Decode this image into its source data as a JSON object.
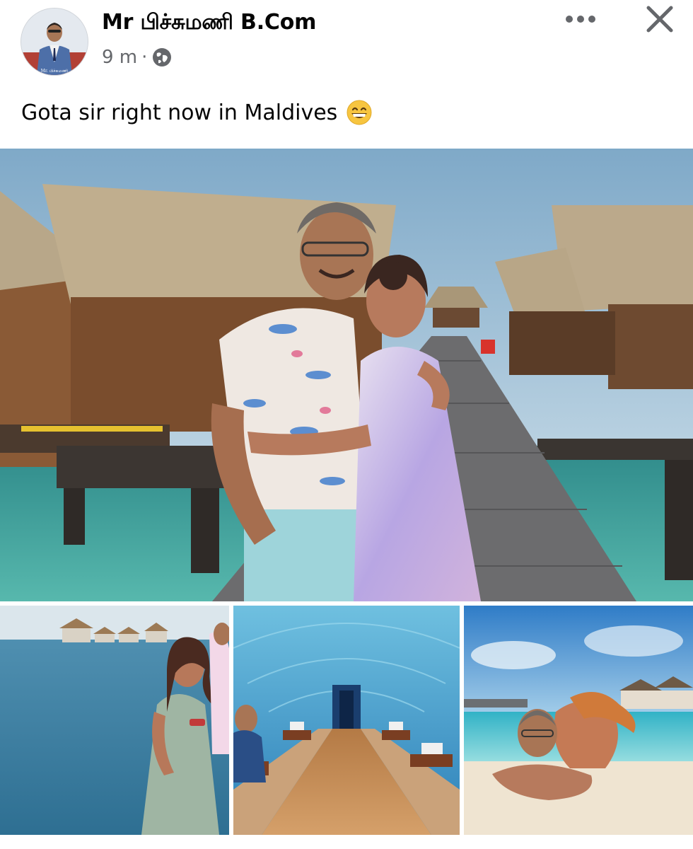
{
  "post": {
    "author": "Mr பிச்சுமணி B.Com",
    "timestamp": "9 m",
    "separator": "·",
    "audience_icon": "globe-icon",
    "caption": "Gota sir right now in Maldives",
    "caption_emoji": "grinning-face-icon",
    "header_icons": [
      "more-options-icon",
      "close-icon"
    ],
    "avatar_text": "Mr. பிச்சுமணி",
    "photos": [
      {
        "id": "main",
        "description_icon": "overwater-villa-photo"
      },
      {
        "id": "sea",
        "description_icon": "sea-photo"
      },
      {
        "id": "aquarium",
        "description_icon": "underwater-restaurant-photo"
      },
      {
        "id": "beach",
        "description_icon": "beach-photo"
      }
    ]
  },
  "colors": {
    "name": "#050505",
    "meta": "#65676b",
    "sky": "#a9c6d8",
    "water": "#3e9a97"
  }
}
